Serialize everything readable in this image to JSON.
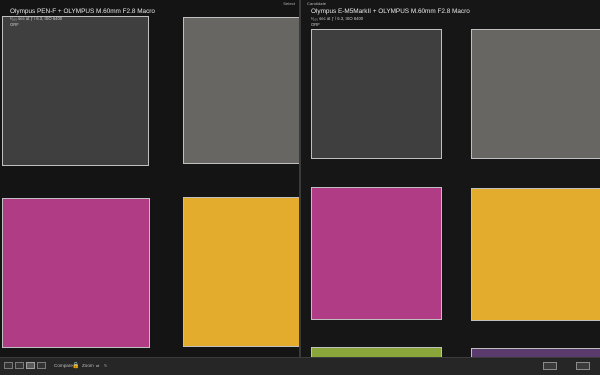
{
  "left_pane": {
    "tag": "Select",
    "title": "Olympus PEN-F + OLYMPUS M.60mm F2.8 Macro",
    "exposure": "¹⁄₁₀₀ sec at ƒ / 6.3, ISO 6400",
    "file_type": "ORF"
  },
  "right_pane": {
    "tag": "Candidate",
    "title": "Olympus E-M5MarkII + OLYMPUS M.60mm F2.8 Macro",
    "exposure": "¹⁄₁₀₀ sec at ƒ / 6.3, ISO 6400",
    "file_type": "ORF"
  },
  "patch_colors": {
    "dark_gray": "#3f3f3f",
    "light_gray": "#686663",
    "magenta": "#b13c86",
    "yellow": "#e4ac2c",
    "green": "#8aa63a",
    "purple": "#5b3b6e"
  },
  "toolbar": {
    "compare_label": "Compare",
    "zoom_label": "Zoom",
    "view_modes": [
      "grid-view-icon",
      "loupe-view-icon",
      "compare-view-icon",
      "survey-view-icon"
    ]
  }
}
